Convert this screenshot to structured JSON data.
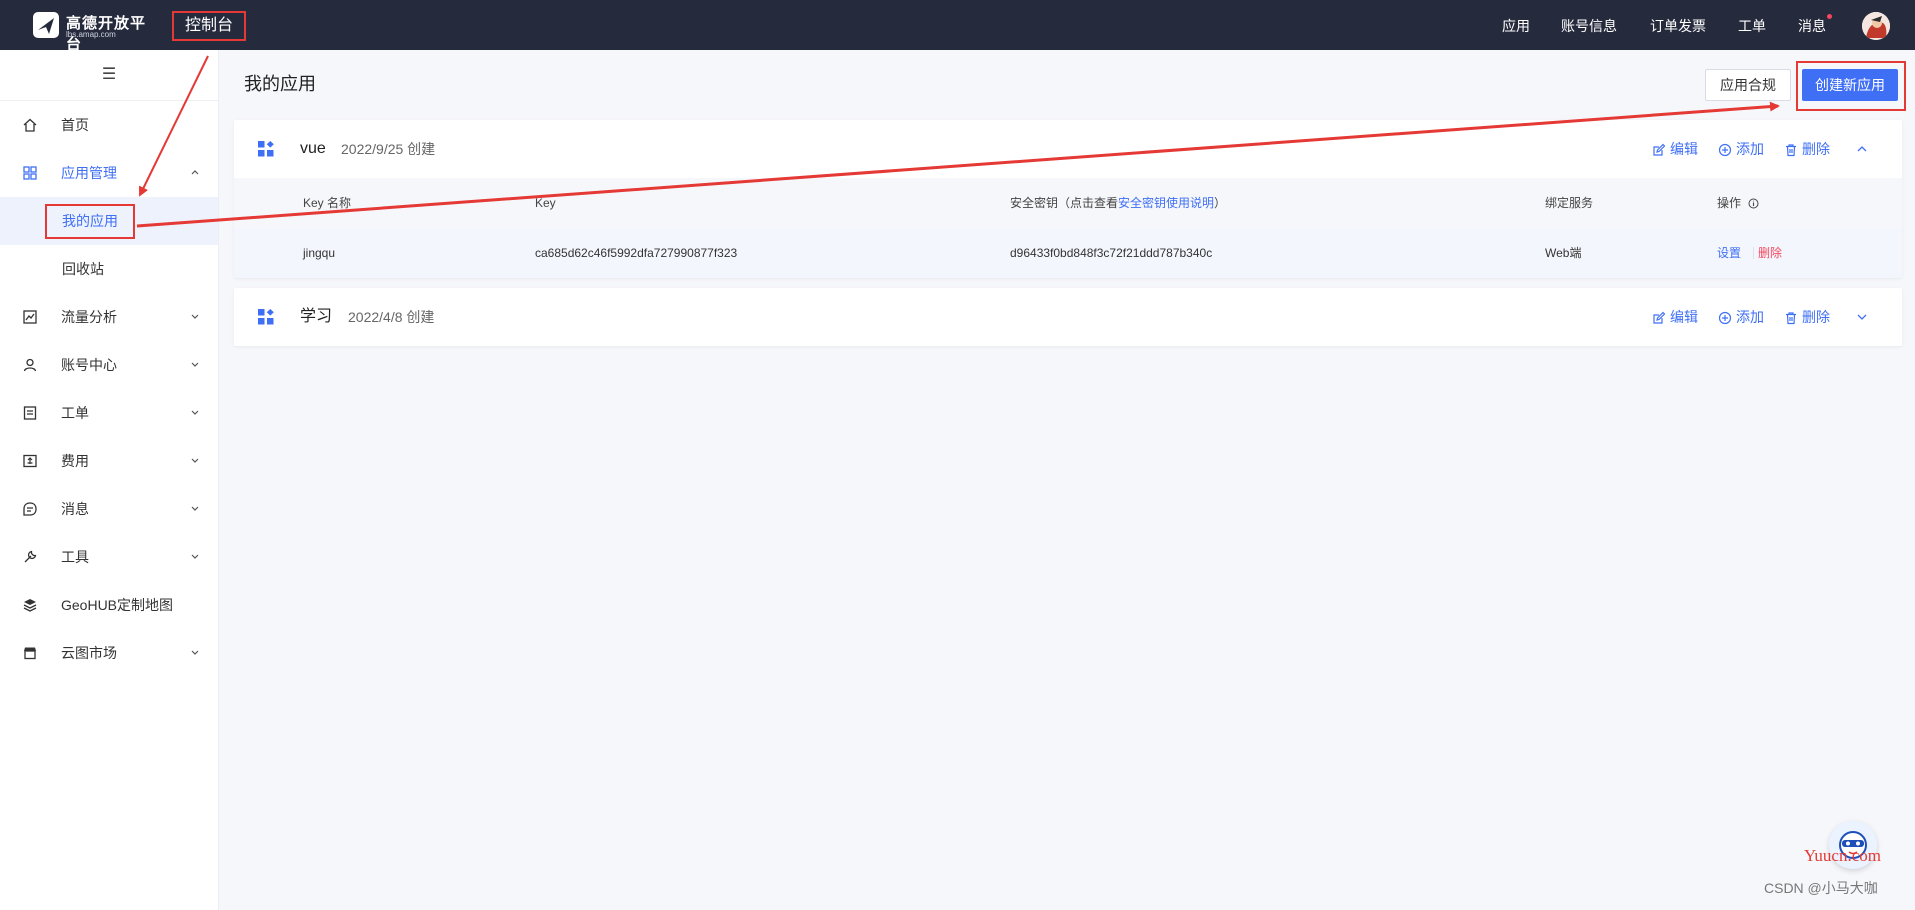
{
  "topbar": {
    "logo_title": "高德开放平台",
    "logo_sub": "lbs.amap.com",
    "console": "控制台",
    "nav": [
      "应用",
      "账号信息",
      "订单发票",
      "工单",
      "消息"
    ]
  },
  "sidebar": {
    "toggle": "☰",
    "items": [
      {
        "label": "首页",
        "icon": "home-icon"
      },
      {
        "label": "应用管理",
        "icon": "grid-icon"
      },
      {
        "label": "我的应用"
      },
      {
        "label": "回收站"
      },
      {
        "label": "流量分析",
        "icon": "chart-icon"
      },
      {
        "label": "账号中心",
        "icon": "user-icon"
      },
      {
        "label": "工单",
        "icon": "ticket-icon"
      },
      {
        "label": "费用",
        "icon": "fee-icon"
      },
      {
        "label": "消息",
        "icon": "message-icon"
      },
      {
        "label": "工具",
        "icon": "wrench-icon"
      },
      {
        "label": "GeoHUB定制地图",
        "icon": "layers-icon"
      },
      {
        "label": "云图市场",
        "icon": "store-icon"
      }
    ]
  },
  "main": {
    "title": "我的应用",
    "compliance_btn": "应用合规",
    "create_btn": "创建新应用",
    "actions": {
      "edit": "编辑",
      "add": "添加",
      "delete": "删除"
    },
    "apps": [
      {
        "name": "vue",
        "created": "2022/9/25 创建",
        "table": {
          "headers": {
            "key_name": "Key 名称",
            "key": "Key",
            "secret_prefix": "安全密钥（点击查看",
            "secret_link": "安全密钥使用说明",
            "secret_suffix": "）",
            "service": "绑定服务",
            "ops": "操作"
          },
          "rows": [
            {
              "key_name": "jingqu",
              "key": "ca685d62c46f5992dfa727990877f323",
              "secret": "d96433f0bd848f3c72f21ddd787b340c",
              "service": "Web端",
              "op_set": "设置",
              "op_delete": "删除"
            }
          ]
        }
      },
      {
        "name": "学习",
        "created": "2022/4/8 创建"
      }
    ]
  },
  "watermark": "CSDN @小马大咖",
  "float_text": "Yuucn.com",
  "colors": {
    "accent": "#3f6ff5",
    "topbar": "#252a3d",
    "danger": "#f5475e",
    "annotation": "#e53935"
  }
}
